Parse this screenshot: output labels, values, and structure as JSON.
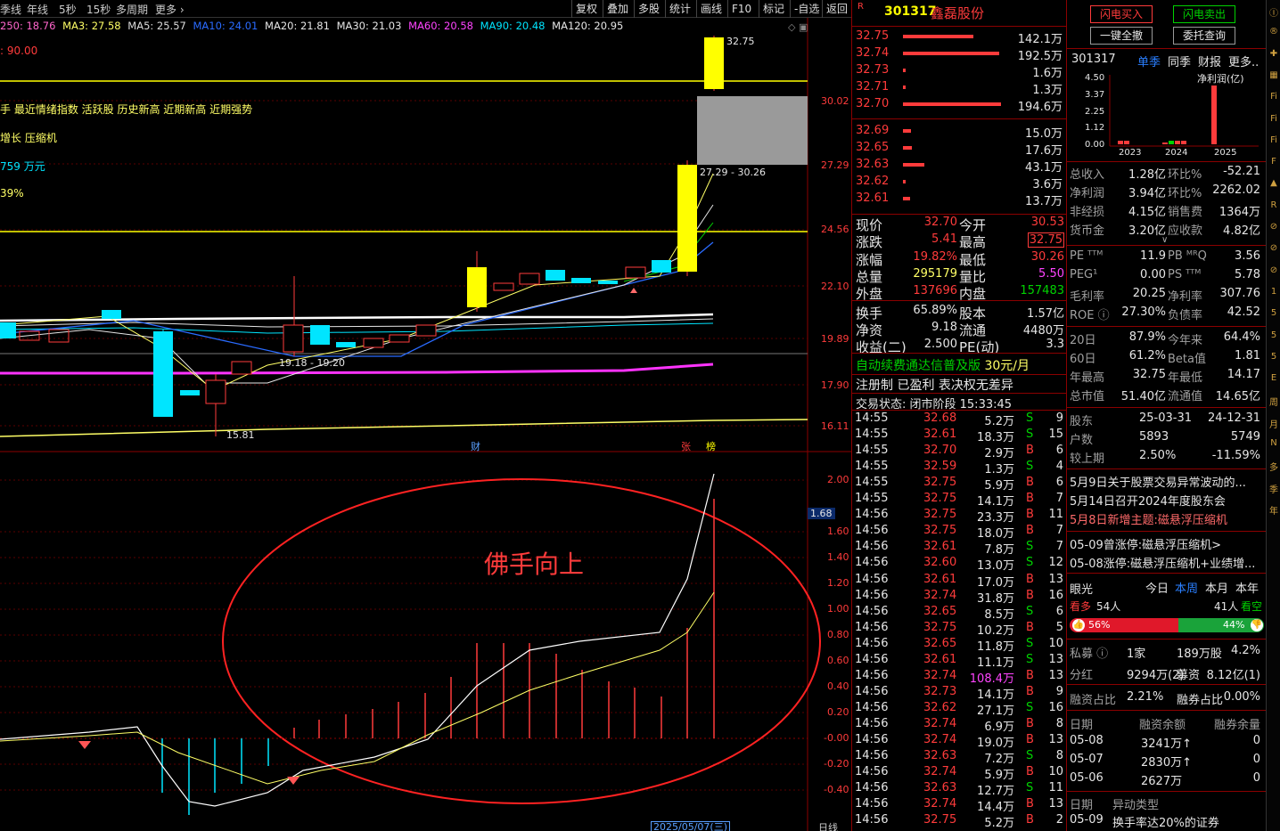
{
  "toolbar": {
    "left_items": [
      "季线",
      "年线",
      "5秒",
      "15秒",
      "多周期",
      "更多"
    ],
    "right_buttons": [
      "复权",
      "叠加",
      "多股",
      "统计",
      "画线",
      "F10",
      "标记",
      "-自选",
      "返回"
    ]
  },
  "ma_bar": {
    "ma250": "250: 18.76",
    "ma3": "MA3: 27.58",
    "ma5": "MA5: 25.57",
    "ma10": "MA10: 24.01",
    "ma20": "MA20: 21.81",
    "ma30": "MA30: 21.03",
    "ma60": "MA60: 20.58",
    "ma90": "MA90: 20.48",
    "ma120": "MA120: 20.95"
  },
  "chart_overlay": {
    "score": ": 90.00",
    "tags": "手 最近情绪指数 活跃股 历史新高 近期新高 近期强势",
    "concepts": "增长 压缩机",
    "amount": "759 万元",
    "pct": "39%",
    "high_label": "32.75",
    "gap_label": "27.29 - 30.26",
    "range_label": "19.18 - 19.20",
    "low_label": "15.81",
    "marker_cai": "财",
    "marker_zhang": "张",
    "marker_bang": "榜",
    "indicator_title": "佛手向上",
    "indicator_value": "1.68",
    "date_label": "2025/05/07(三)",
    "axis_right_bottom": "日线"
  },
  "price_axis": [
    "30.02",
    "27.29",
    "24.56",
    "22.10",
    "19.89",
    "17.90",
    "16.11"
  ],
  "ind_axis": [
    "2.00",
    "1.60",
    "1.40",
    "1.20",
    "1.00",
    "0.80",
    "0.60",
    "0.40",
    "0.20",
    "-0.00",
    "-0.20",
    "-0.40"
  ],
  "stock": {
    "code": "301317",
    "name": "鑫磊股份",
    "badge": "R"
  },
  "sell_levels": [
    {
      "price": "32.75",
      "vol": "142.1万",
      "w": 0.72
    },
    {
      "price": "32.74",
      "vol": "192.5万",
      "w": 0.98
    },
    {
      "price": "32.73",
      "vol": "1.6万",
      "w": 0.02
    },
    {
      "price": "32.71",
      "vol": "1.3万",
      "w": 0.02
    },
    {
      "price": "32.70",
      "vol": "194.6万",
      "w": 1.0
    }
  ],
  "buy_levels": [
    {
      "price": "32.69",
      "vol": "15.0万",
      "w": 0.08
    },
    {
      "price": "32.65",
      "vol": "17.6万",
      "w": 0.09
    },
    {
      "price": "32.63",
      "vol": "43.1万",
      "w": 0.22
    },
    {
      "price": "32.62",
      "vol": "3.6万",
      "w": 0.02
    },
    {
      "price": "32.61",
      "vol": "13.7万",
      "w": 0.07
    }
  ],
  "quote": [
    {
      "l1": "现价",
      "v1": "32.70",
      "l2": "今开",
      "v2": "30.53"
    },
    {
      "l1": "涨跌",
      "v1": "5.41",
      "l2": "最高",
      "v2": "32.75"
    },
    {
      "l1": "涨幅",
      "v1": "19.82%",
      "l2": "最低",
      "v2": "30.26"
    },
    {
      "l1": "总量",
      "v1": "295179",
      "l2": "量比",
      "v2": "5.50"
    },
    {
      "l1": "外盘",
      "v1": "137696",
      "l2": "内盘",
      "v2": "157483"
    },
    {
      "l1": "换手",
      "v1": "65.89%",
      "l2": "股本",
      "v2": "1.57亿"
    },
    {
      "l1": "净资",
      "v1": "9.18",
      "l2": "流通",
      "v2": "4480万"
    },
    {
      "l1": "收益(二)",
      "v1": "2.500",
      "l2": "PE(动)",
      "v2": "3.3"
    }
  ],
  "notices": {
    "ad": "自动续费通达信普及版",
    "ad_price": "30元/月",
    "reg": "注册制 已盈利 表决权无差异",
    "status": "交易状态: 闭市阶段 15:33:45"
  },
  "ticks": [
    {
      "t": "14:55",
      "p": "32.68",
      "v": "5.2万",
      "d": "S",
      "n": "9"
    },
    {
      "t": "14:55",
      "p": "32.61",
      "v": "18.3万",
      "d": "S",
      "n": "15"
    },
    {
      "t": "14:55",
      "p": "32.70",
      "v": "2.9万",
      "d": "B",
      "n": "6"
    },
    {
      "t": "14:55",
      "p": "32.59",
      "v": "1.3万",
      "d": "S",
      "n": "4"
    },
    {
      "t": "14:55",
      "p": "32.75",
      "v": "5.9万",
      "d": "B",
      "n": "6"
    },
    {
      "t": "14:55",
      "p": "32.75",
      "v": "14.1万",
      "d": "B",
      "n": "7"
    },
    {
      "t": "14:56",
      "p": "32.75",
      "v": "23.3万",
      "d": "B",
      "n": "11"
    },
    {
      "t": "14:56",
      "p": "32.75",
      "v": "18.0万",
      "d": "B",
      "n": "7"
    },
    {
      "t": "14:56",
      "p": "32.61",
      "v": "7.8万",
      "d": "S",
      "n": "7"
    },
    {
      "t": "14:56",
      "p": "32.60",
      "v": "13.0万",
      "d": "S",
      "n": "12"
    },
    {
      "t": "14:56",
      "p": "32.61",
      "v": "17.0万",
      "d": "B",
      "n": "13"
    },
    {
      "t": "14:56",
      "p": "32.74",
      "v": "31.8万",
      "d": "B",
      "n": "16"
    },
    {
      "t": "14:56",
      "p": "32.65",
      "v": "8.5万",
      "d": "S",
      "n": "6"
    },
    {
      "t": "14:56",
      "p": "32.75",
      "v": "10.2万",
      "d": "B",
      "n": "5"
    },
    {
      "t": "14:56",
      "p": "32.65",
      "v": "11.8万",
      "d": "S",
      "n": "10"
    },
    {
      "t": "14:56",
      "p": "32.61",
      "v": "11.1万",
      "d": "S",
      "n": "13"
    },
    {
      "t": "14:56",
      "p": "32.74",
      "v": "108.4万",
      "d": "B",
      "n": "13"
    },
    {
      "t": "14:56",
      "p": "32.73",
      "v": "14.1万",
      "d": "B",
      "n": "9"
    },
    {
      "t": "14:56",
      "p": "32.62",
      "v": "27.1万",
      "d": "S",
      "n": "16"
    },
    {
      "t": "14:56",
      "p": "32.74",
      "v": "6.9万",
      "d": "B",
      "n": "8"
    },
    {
      "t": "14:56",
      "p": "32.74",
      "v": "19.0万",
      "d": "B",
      "n": "13"
    },
    {
      "t": "14:56",
      "p": "32.63",
      "v": "7.2万",
      "d": "S",
      "n": "8"
    },
    {
      "t": "14:56",
      "p": "32.74",
      "v": "5.9万",
      "d": "B",
      "n": "10"
    },
    {
      "t": "14:56",
      "p": "32.63",
      "v": "12.7万",
      "d": "S",
      "n": "11"
    },
    {
      "t": "14:56",
      "p": "32.74",
      "v": "14.4万",
      "d": "B",
      "n": "13"
    },
    {
      "t": "14:56",
      "p": "32.75",
      "v": "5.2万",
      "d": "B",
      "n": "2"
    }
  ],
  "trade_buttons": {
    "buy": "闪电买入",
    "sell": "闪电卖出",
    "cancel": "一键全撤",
    "query": "委托查询"
  },
  "fin_header": {
    "code": "301317",
    "tab1": "单季",
    "tab2": "同季",
    "tab3": "财报",
    "tab4": "更多.."
  },
  "profit_chart": {
    "title": "净利润(亿)",
    "yticks": [
      "4.50",
      "3.37",
      "2.25",
      "1.12",
      "0.00"
    ],
    "xticks": [
      "2023",
      "2024",
      "2025"
    ]
  },
  "fin_rows": [
    {
      "a": "总收入",
      "b": "1.28亿",
      "c": "环比%",
      "d": "-52.21"
    },
    {
      "a": "净利润",
      "b": "3.94亿",
      "c": "环比%",
      "d": "2262.02"
    },
    {
      "a": "非经损",
      "b": "4.15亿",
      "c": "销售费",
      "d": "1364万"
    },
    {
      "a": "货币金",
      "b": "3.20亿",
      "c": "应收款",
      "d": "4.82亿"
    }
  ],
  "val_rows": [
    {
      "a": "PE ᵀᵀᴹ",
      "b": "11.9",
      "c": "PB ᴹᴿQ",
      "d": "3.56"
    },
    {
      "a": "PEG¹",
      "b": "0.00",
      "c": "PS ᵀᵀᴹ",
      "d": "5.78"
    },
    {
      "a": "毛利率",
      "b": "20.25",
      "c": "净利率",
      "d": "307.76"
    },
    {
      "a": "ROE ⓘ",
      "b": "27.30%",
      "c": "负债率",
      "d": "42.52"
    }
  ],
  "perf_rows": [
    {
      "a": "20日",
      "b": "87.9%",
      "c": "今年来",
      "d": "64.4%"
    },
    {
      "a": "60日",
      "b": "61.2%",
      "c": "Beta值",
      "d": "1.81"
    },
    {
      "a": "年最高",
      "b": "32.75",
      "c": "年最低",
      "d": "14.17"
    },
    {
      "a": "总市值",
      "b": "51.40亿",
      "c": "流通值",
      "d": "14.65亿"
    }
  ],
  "holder_rows": [
    {
      "a": "股东",
      "b": "25-03-31",
      "c": "24-12-31"
    },
    {
      "a": "户数",
      "b": "5893",
      "c": "5749"
    },
    {
      "a": "较上期",
      "b": "2.50%",
      "c": "-11.59%"
    }
  ],
  "news": [
    "5月9日关于股票交易异常波动的...",
    "5月14日召开2024年度股东会",
    "5月8日新增主题:磁悬浮压缩机"
  ],
  "limit_news": [
    "05-09曾涨停:磁悬浮压缩机>",
    "05-08涨停:磁悬浮压缩机+业绩增..."
  ],
  "eye": {
    "title": "眼光",
    "t1": "今日",
    "t2": "本周",
    "t3": "本月",
    "t4": "本年",
    "bear_label": "看多",
    "bear_count": "54人",
    "bull_count": "41人",
    "bull_label": "看空",
    "bear_pct": "56%",
    "bull_pct": "44%",
    "bear_ratio": 0.56
  },
  "private": {
    "a": "私募 ⓘ",
    "b": "1家",
    "c": "189万股",
    "d": "4.2%"
  },
  "dividend": {
    "a": "分红",
    "b": "9294万(2)",
    "c": "募资",
    "d": "8.12亿(1)"
  },
  "margin": {
    "a": "融资占比",
    "b": "2.21%",
    "c": "融券占比",
    "d": "0.00%"
  },
  "margin_table": {
    "h1": "日期",
    "h2": "融资余额",
    "h3": "融券余量",
    "rows": [
      {
        "d": "05-08",
        "v": "3241万↑",
        "q": "0"
      },
      {
        "d": "05-07",
        "v": "2830万↑",
        "q": "0"
      },
      {
        "d": "05-06",
        "v": "2627万",
        "q": "0"
      }
    ]
  },
  "anomaly": {
    "h1": "日期",
    "h2": "异动类型",
    "d": "05-09",
    "t": "换手率达20%的证券"
  },
  "side_icons": [
    "Ⓘ",
    "®",
    "✚",
    "▦",
    "Fi",
    "Fi",
    "Fi",
    "F",
    "▲",
    "R",
    "⊘",
    "⊘",
    "⊘",
    "1",
    "5",
    "5",
    "5",
    "E",
    "周",
    "月",
    "N",
    "多",
    "季",
    "年"
  ],
  "colors": {
    "up": "#ff3b3b",
    "down": "#00e5ff",
    "accent": "#ffff00",
    "grid_red": "#8b0000"
  }
}
